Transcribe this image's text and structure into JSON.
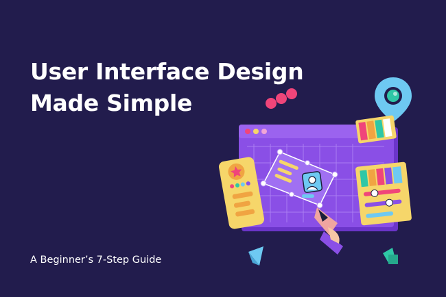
{
  "headline": {
    "line1": "User Interface Design",
    "line2": "Made Simple"
  },
  "tagline": "A Beginner’s 7-Step Guide",
  "colors": {
    "background": "#221c4d",
    "canvas": "#8a4fe6",
    "canvas_dark": "#6b35c9",
    "accent_pink": "#f0457a",
    "accent_yellow": "#f6d66a",
    "accent_teal": "#2fc7a6",
    "accent_blue": "#6ec9f2"
  },
  "icons": [
    "map-pin-icon",
    "star-icon",
    "user-avatar-icon",
    "pen-tool-icon"
  ]
}
